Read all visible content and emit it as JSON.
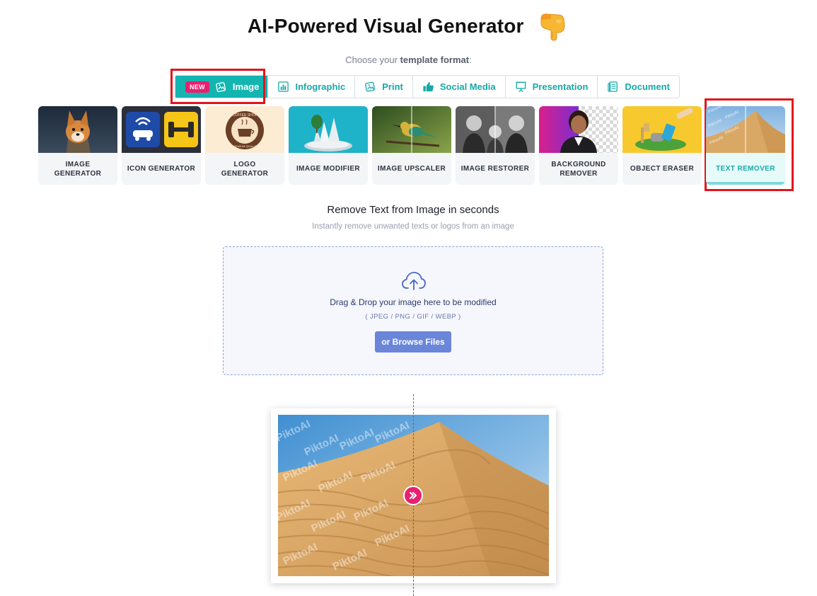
{
  "page": {
    "title": "AI-Powered Visual Generator",
    "hand_icon": "pointing-down-hand-emoji"
  },
  "format_selector": {
    "prompt_prefix": "Choose your",
    "prompt_bold": "template format",
    "prompt_suffix": ":",
    "tabs": [
      {
        "label": "Image",
        "badge": "NEW",
        "icon": "image-icon",
        "active": true
      },
      {
        "label": "Infographic",
        "icon": "bar-chart-icon",
        "active": false
      },
      {
        "label": "Print",
        "icon": "print-image-icon",
        "active": false
      },
      {
        "label": "Social Media",
        "icon": "thumbs-up-icon",
        "active": false
      },
      {
        "label": "Presentation",
        "icon": "presentation-board-icon",
        "active": false
      },
      {
        "label": "Document",
        "icon": "document-icon",
        "active": false
      }
    ]
  },
  "tools": [
    {
      "label": "IMAGE GENERATOR",
      "selected": false
    },
    {
      "label": "ICON GENERATOR",
      "selected": false
    },
    {
      "label": "LOGO GENERATOR",
      "logo_text": "COFFEE SHOP",
      "logo_sub": "PREMIUM QUALITY",
      "selected": false
    },
    {
      "label": "IMAGE MODIFIER",
      "selected": false
    },
    {
      "label": "IMAGE UPSCALER",
      "selected": false
    },
    {
      "label": "IMAGE RESTORER",
      "selected": false
    },
    {
      "label": "BACKGROUND REMOVER",
      "selected": false
    },
    {
      "label": "OBJECT ERASER",
      "selected": false
    },
    {
      "label": "TEXT REMOVER",
      "selected": true
    }
  ],
  "remover": {
    "title": "Remove Text from Image in seconds",
    "subtitle": "Instantly remove unwanted texts or logos from an image",
    "dropzone_text": "Drag & Drop your image here to be modified",
    "formats": "( JPEG / PNG / GIF / WEBP )",
    "browse_label": "or Browse Files",
    "watermark_text": "PiktoAI"
  },
  "colors": {
    "accent": "#14b5b0",
    "badge": "#e8206e",
    "highlight": "#e1151a",
    "browse_button": "#6a86d9"
  }
}
